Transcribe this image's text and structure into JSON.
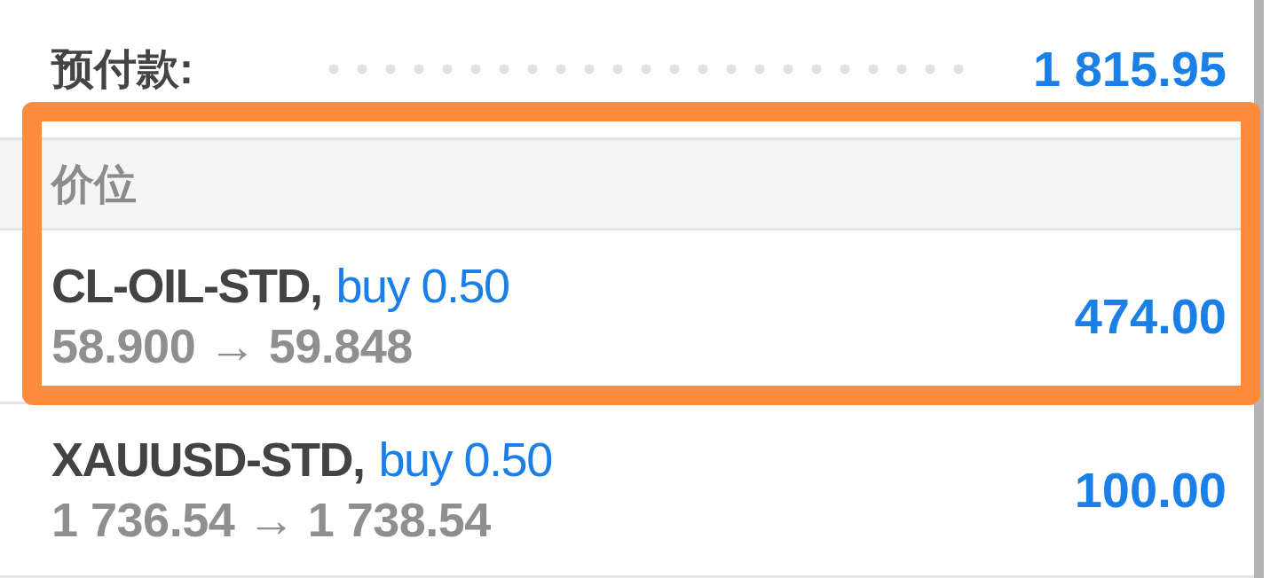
{
  "account": {
    "label": "预付款:",
    "value": "1 815.95"
  },
  "positions": {
    "title": "价位",
    "rows": [
      {
        "symbol": "CL-OIL-STD,",
        "order": "buy 0.50",
        "prices": "58.900 → 59.848",
        "profit": "474.00",
        "highlighted": true
      },
      {
        "symbol": "XAUUSD-STD,",
        "order": "buy 0.50",
        "prices": "1 736.54 → 1 738.54",
        "profit": "100.00",
        "highlighted": false
      }
    ]
  }
}
